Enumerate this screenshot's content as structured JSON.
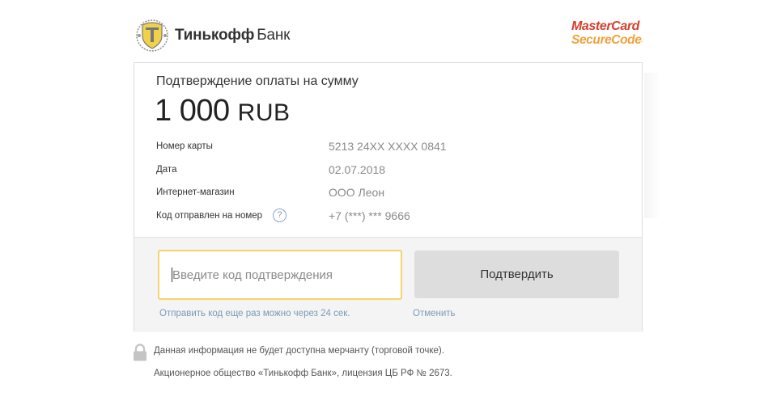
{
  "header": {
    "bank_name_bold": "Тинькофф",
    "bank_name_plain": "Банк",
    "mastercard_line1": "MasterCard",
    "mastercard_line2": "SecureCode",
    "mastercard_tm": ".",
    "emblem_icon": "tinkoff-shield-icon",
    "brand_colors": {
      "mastercard_red": "#d3412e",
      "mastercard_orange": "#f1a13a"
    }
  },
  "payment": {
    "title": "Подтверждение оплаты на сумму",
    "amount": "1 000",
    "currency": "RUB",
    "details": [
      {
        "label": "Номер карты",
        "value": "5213 24XX XXXX 0841"
      },
      {
        "label": "Дата",
        "value": "02.07.2018"
      },
      {
        "label": "Интернет-магазин",
        "value": "ООО Леон"
      },
      {
        "label": "Код отправлен на номер",
        "value": "+7 (***) *** 9666",
        "help": "?"
      }
    ]
  },
  "form": {
    "code_value": "",
    "code_placeholder": "Введите код подтверждения",
    "confirm_label": "Подтвердить",
    "resend_text": "Отправить код еще раз можно через 24 сек.",
    "cancel_label": "Отменить",
    "input_focus_color": "#f3d46d"
  },
  "footer": {
    "lock_icon": "lock-icon",
    "privacy_note": "Данная информация не будет доступна мерчанту (торговой точке).",
    "license_note": "Акционерное общество «Тинькофф Банк», лицензия ЦБ РФ № 2673."
  }
}
